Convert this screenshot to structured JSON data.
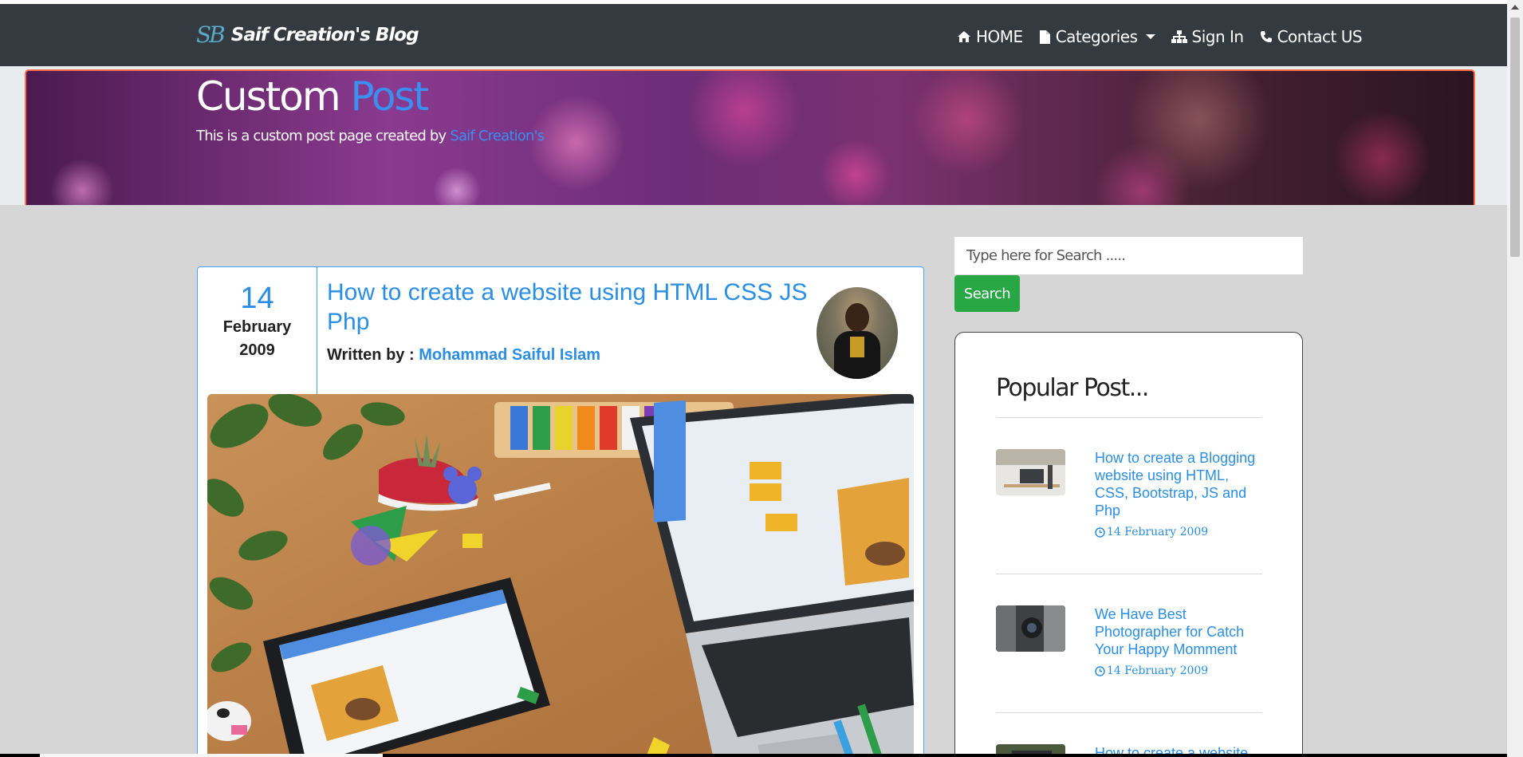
{
  "brand": {
    "logo": "SB",
    "name": "Saif Creation's Blog"
  },
  "nav": {
    "home": "HOME",
    "categories": "Categories",
    "sign_in": "Sign In",
    "contact": "Contact US"
  },
  "banner": {
    "title_main": "Custom",
    "title_accent": "Post",
    "subtitle_prefix": "This is a custom post page created by",
    "subtitle_link": "Saif Creation's"
  },
  "post": {
    "day": "14",
    "month": "February",
    "year": "2009",
    "title": "How to create a website using HTML CSS JS Php",
    "written_by_label": "Written by :",
    "author": "Mohammad Saiful Islam"
  },
  "search": {
    "placeholder": "Type here for Search .....",
    "button": "Search"
  },
  "popular": {
    "heading": "Popular Post...",
    "items": [
      {
        "title": "How to create a Blogging website using HTML, CSS, Bootstrap, JS and Php",
        "date": "14 February 2009"
      },
      {
        "title": "We Have Best Photographer for Catch Your Happy Momment",
        "date": "14 February 2009"
      },
      {
        "title": "How to create a website",
        "date": ""
      }
    ]
  },
  "colors": {
    "navbar": "#343a40",
    "accent_blue": "#2a8ee6",
    "search_button": "#28a745",
    "banner_border": "#ff6b4a"
  },
  "icons": [
    "home-icon",
    "file-icon",
    "sitemap-icon",
    "phone-icon",
    "clock-icon"
  ]
}
